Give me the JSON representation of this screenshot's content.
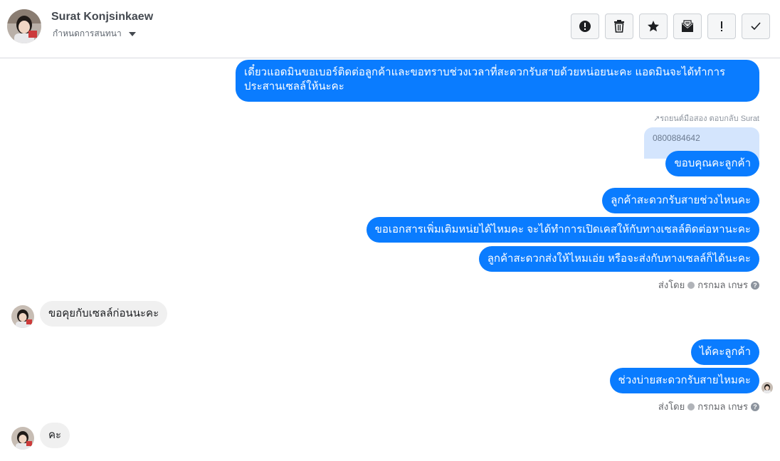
{
  "header": {
    "contact_name": "Surat Konjsinkaew",
    "conversation_settings_label": "กำหนดการสนทนา"
  },
  "toolbar": {
    "icons": [
      "alert-circle-icon",
      "trash-icon",
      "star-icon",
      "mail-icon",
      "exclamation-icon",
      "check-icon"
    ]
  },
  "messages": {
    "m1": "เดี๋ยวแอดมินขอเบอร์ติดต่อลูกค้าและขอทราบช่วงเวลาที่สะดวกรับสายด้วยหน่อยนะคะ แอดมินจะได้ทำการ",
    "m1_line2": "ประสานเซลล์ให้นะคะ",
    "reply_meta": "↗รถยนต์มือสอง ตอบกลับ Surat",
    "quoted_text": "0800884642",
    "m2": "ขอบคุณคะลูกค้า",
    "m3": "ลูกค้าสะดวกรับสายช่วงไหนคะ",
    "m4": "ขอเอกสารเพิ่มเติมหน่ยได้ไหมคะ จะได้ทำการเปิดเคสให้กับทางเซลล์ติดต่อหานะคะ",
    "m5": "ลูกค้าสะดวกส่งให้ไหมเอ่ย หรือจะส่งกับทางเซลล์ก็ได้นะคะ",
    "sent_by_1_prefix": "ส่งโดย",
    "sent_by_1_name": "กรกมล เกษร",
    "in1": "ขอคุยกับเซลล์ก่อนนะคะ",
    "m6": "ได้คะลูกค้า",
    "m7": "ช่วงบ่ายสะดวกรับสายไหมคะ",
    "sent_by_2_prefix": "ส่งโดย",
    "sent_by_2_name": "กรกมล เกษร",
    "in2": "คะ"
  },
  "colors": {
    "outgoing_bubble": "#0a7cff",
    "incoming_bubble": "#f0f0f0",
    "quoted_bubble": "#d4e5fd"
  }
}
